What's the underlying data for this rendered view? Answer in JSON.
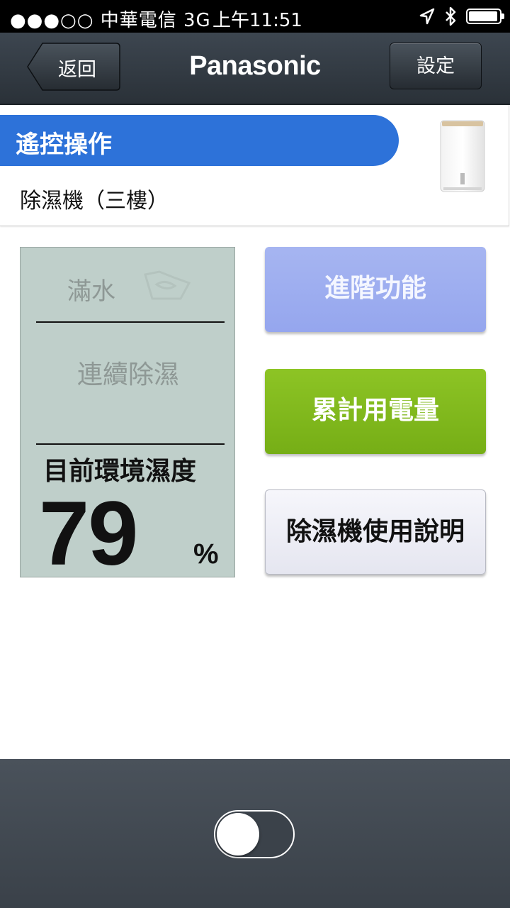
{
  "status_bar": {
    "carrier": "●●●○○ 中華電信   3G",
    "time": "上午11:51",
    "icons": [
      "location-arrow-icon",
      "bluetooth-icon",
      "battery-icon"
    ]
  },
  "nav": {
    "back_label": "返回",
    "brand": "Panasonic",
    "settings_label": "設定"
  },
  "device": {
    "mode_label": "遙控操作",
    "name": "除濕機（三樓）",
    "image_icon": "dehumidifier-icon"
  },
  "lcd": {
    "full_water": "滿水",
    "water_icon": "water-tank-icon",
    "continuous": "連續除濕",
    "humidity_label": "目前環境濕度",
    "humidity_value": "79",
    "unit": "%"
  },
  "actions": {
    "advanced": "進階功能",
    "energy": "累計用電量",
    "manual": "除濕機使用說明"
  },
  "power_toggle": {
    "on": false
  },
  "colors": {
    "accent_blue": "#2d72d9",
    "energy_green": "#7fb81c",
    "advanced_blue": "#9eaef0",
    "lcd_bg": "#bfcfca"
  }
}
